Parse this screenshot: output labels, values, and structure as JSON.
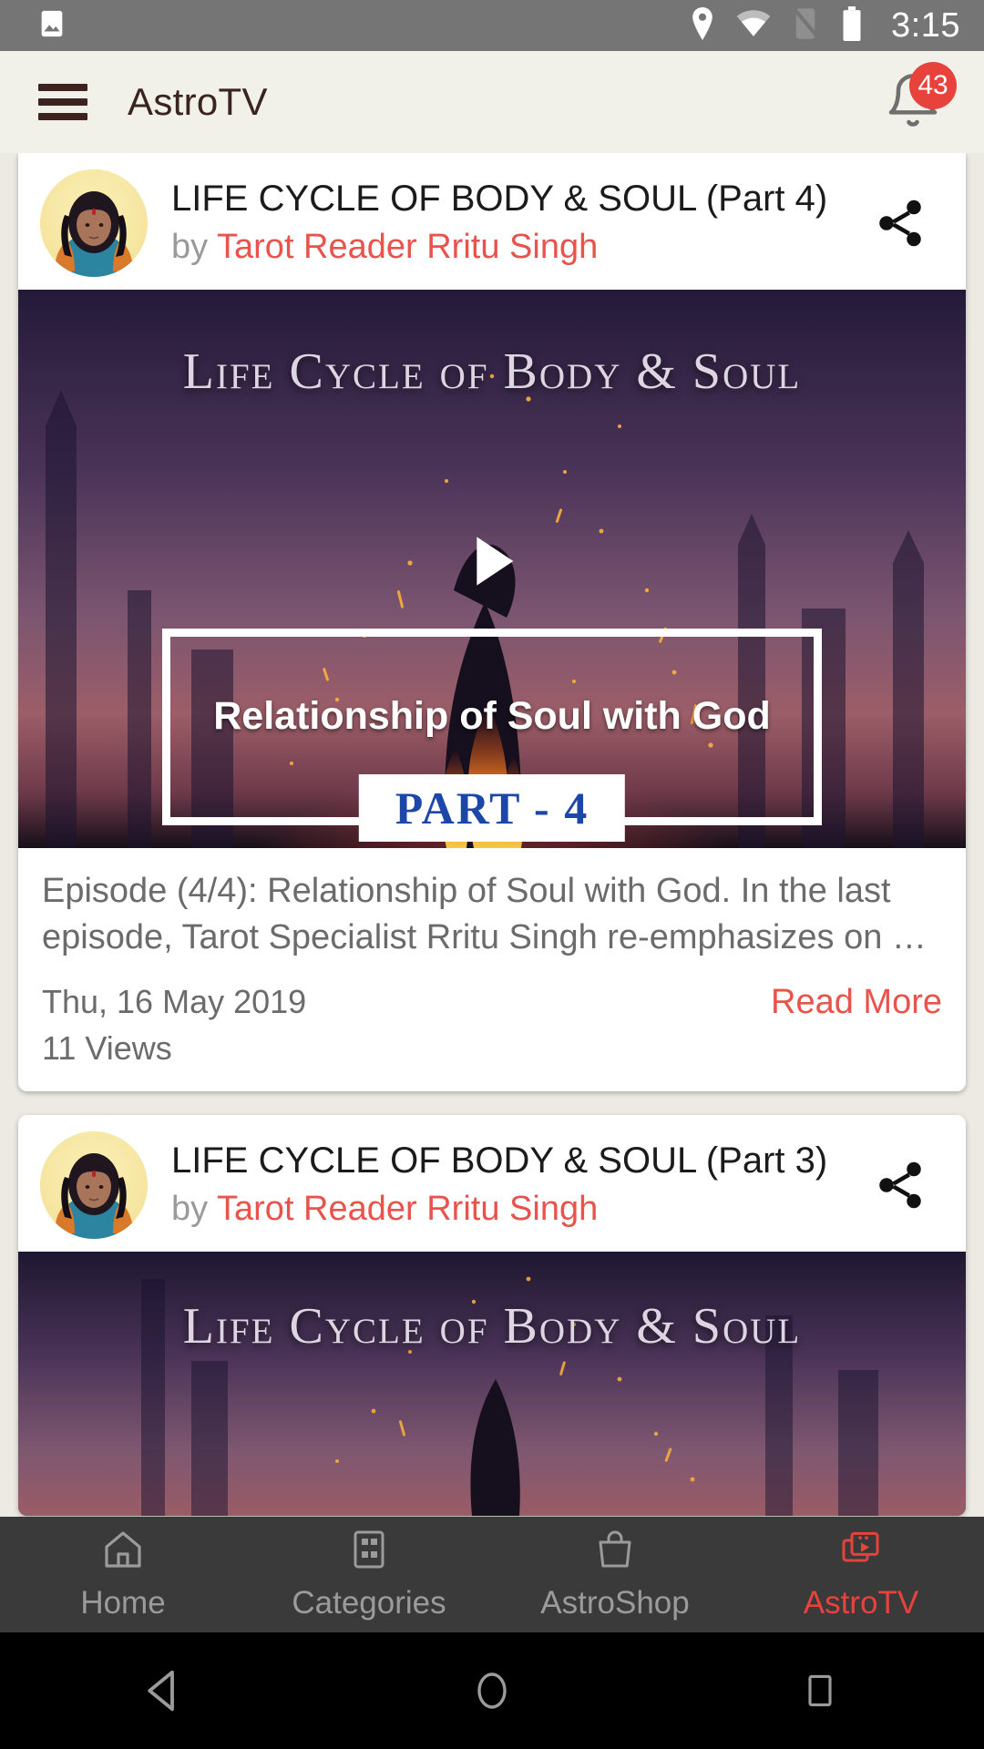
{
  "statusbar": {
    "time": "3:15",
    "icons": [
      "image-icon",
      "location-pin-icon",
      "wifi-icon",
      "signal-off-icon",
      "battery-icon"
    ]
  },
  "appbar": {
    "menu_icon": "hamburger-menu-icon",
    "title": "AstroTV",
    "bell_icon": "notification-bell-icon",
    "notification_count": "43",
    "background": "#f1f0e9",
    "title_color": "#3b2420"
  },
  "theme": {
    "accent_red": "#e8423c",
    "link_red": "#e8534c",
    "page_background": "#eceae3",
    "card_background": "#ffffff",
    "muted_text": "#6b6b6b",
    "status_bar": "#757575",
    "bottom_nav": "#3a3a3a"
  },
  "feed": {
    "cards": [
      {
        "title": "LIFE CYCLE OF BODY & SOUL (Part 4)",
        "by_prefix": "by",
        "author": "Tarot Reader Rritu Singh",
        "share_icon": "share-icon",
        "avatar_alt": "avatar",
        "thumbnail": {
          "banner_title": "Life Cycle of Body & Soul",
          "overlay_title": "Relationship of Soul with God",
          "part_label": "PART - 4",
          "play_icon": "play-icon"
        },
        "description": "Episode (4/4): Relationship of Soul with God. In the last episode, Tarot Specialist Rritu Singh re-emphasizes on …",
        "date": "Thu, 16 May 2019",
        "read_more": "Read More",
        "views": "11 Views"
      },
      {
        "title": "LIFE CYCLE OF BODY & SOUL (Part 3)",
        "by_prefix": "by",
        "author": "Tarot Reader Rritu Singh",
        "share_icon": "share-icon",
        "avatar_alt": "avatar",
        "thumbnail": {
          "banner_title": "Life Cycle of Body & Soul"
        }
      }
    ]
  },
  "bottomnav": {
    "items": [
      {
        "label": "Home",
        "icon": "home-icon",
        "active": false
      },
      {
        "label": "Categories",
        "icon": "grid-icon",
        "active": false
      },
      {
        "label": "AstroShop",
        "icon": "shopping-bag-icon",
        "active": false
      },
      {
        "label": "AstroTV",
        "icon": "tv-video-icon",
        "active": true
      }
    ]
  },
  "androidnav": {
    "back": "back-triangle-icon",
    "home": "home-circle-icon",
    "recents": "recents-square-icon"
  }
}
